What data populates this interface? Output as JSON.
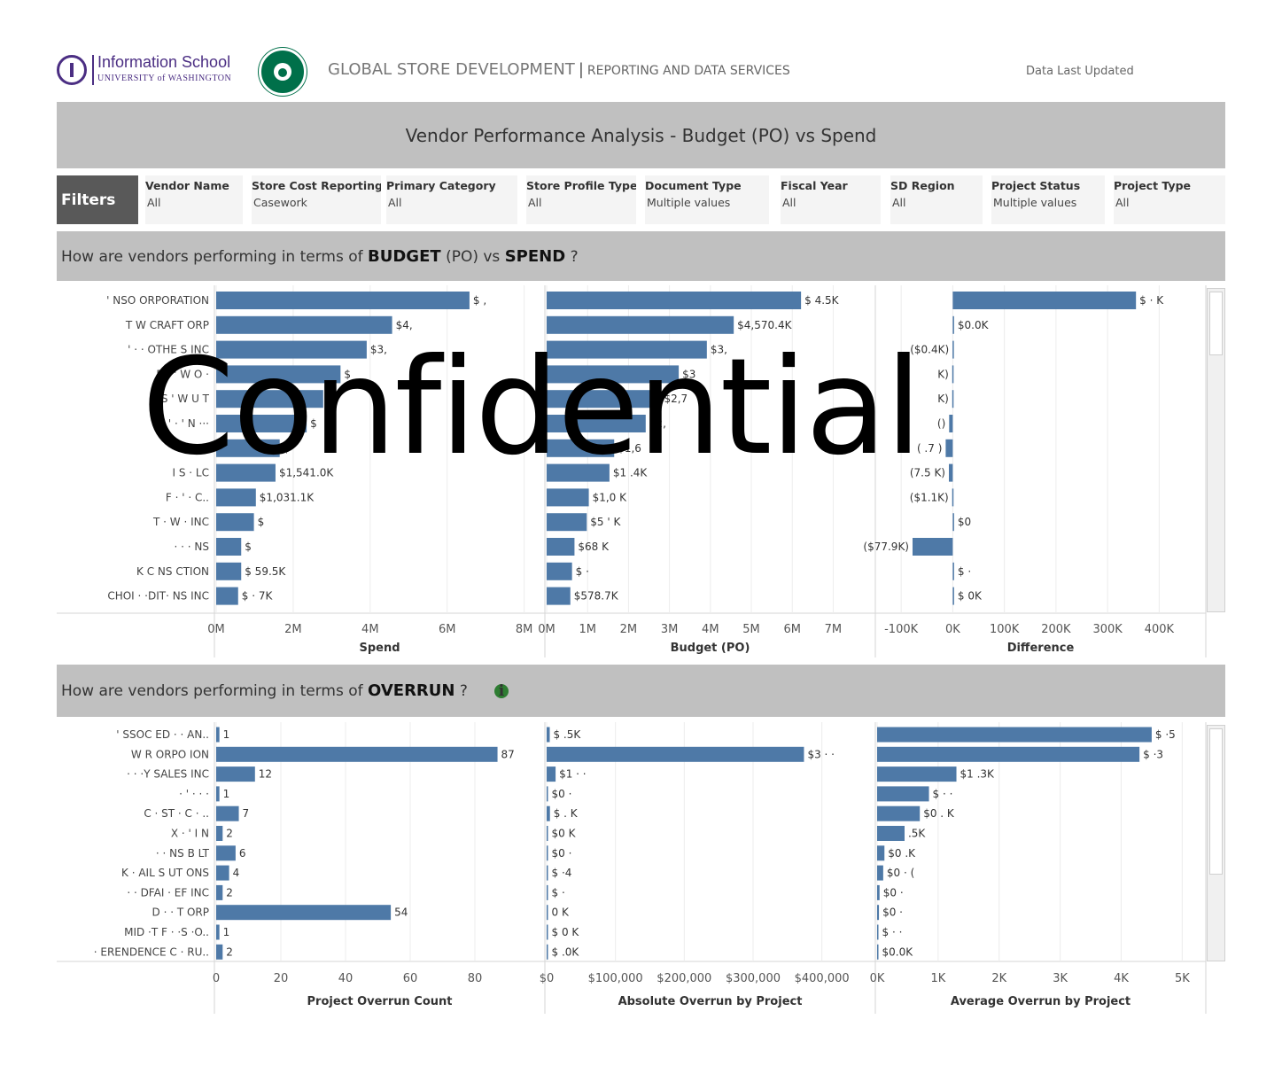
{
  "header": {
    "uw_name": "Information School",
    "uw_sub": "UNIVERSITY of WASHINGTON",
    "gsd": "GLOBAL STORE DEVELOPMENT",
    "sep": "|",
    "rds": "REPORTING AND DATA SERVICES",
    "updated": "Data Last Updated"
  },
  "title": "Vendor Performance Analysis - Budget (PO) vs Spend",
  "filters": {
    "label": "Filters",
    "items": [
      {
        "label": "Vendor Name",
        "value": "All"
      },
      {
        "label": "Store Cost Reporting ..",
        "value": "Casework"
      },
      {
        "label": "Primary Category",
        "value": "All"
      },
      {
        "label": "Store Profile Type",
        "value": "All"
      },
      {
        "label": "Document Type",
        "value": "Multiple values"
      },
      {
        "label": "Fiscal Year",
        "value": "All"
      },
      {
        "label": "SD Region",
        "value": "All"
      },
      {
        "label": "Project Status",
        "value": "Multiple values"
      },
      {
        "label": "Project Type",
        "value": "All"
      }
    ]
  },
  "section1": {
    "prefix": "How are vendors performing in terms of ",
    "emph1": "BUDGET",
    "mid": " (PO) vs ",
    "emph2": "SPEND",
    "suffix": " ?"
  },
  "section2": {
    "prefix": "How are vendors performing in terms of ",
    "emph": "OVERRUN",
    "suffix": " ?",
    "info": "i"
  },
  "watermark": "Confidential",
  "chart_data": [
    {
      "type": "bar",
      "orientation": "horizontal",
      "categories": [
        "' NSO   ORPORATION",
        "  T   W  CRAFT  ORP",
        "  ' ·  ·  OTHE  S INC",
        "  ER  '   W  O ·",
        "  '  S '   W  U  T",
        "' · '   N  ···",
        "  ' ' O    N..",
        "  I    S    ·  LC",
        "F   ·  '  ·   C..",
        "T   ·   W   · INC",
        "  ·   ·  · NS",
        "K  C   NS   CTION",
        "CHOI  ·  ·DIT·  NS INC"
      ],
      "values": [
        6580000,
        4570000,
        3910000,
        3230000,
        2780000,
        2350000,
        1650000,
        1541000,
        1031000,
        980000,
        650000,
        650000,
        570000
      ],
      "labels": [
        "$ ,",
        "$4,",
        "$3,",
        "$",
        "$",
        "$",
        "$",
        "$1,541.0K",
        "$1,031.1K",
        "$",
        "$",
        "$  59.5K",
        "$  ·  7K"
      ],
      "xlabel": "Spend",
      "ticks": [
        "0M",
        "2M",
        "4M",
        "6M",
        "8M"
      ],
      "xlim": [
        0,
        8400000
      ]
    },
    {
      "type": "bar",
      "orientation": "horizontal",
      "categories": [],
      "values": [
        6214500,
        4570400,
        3914000,
        3226900,
        2780000,
        2420000,
        1650000,
        1534400,
        1030000,
        980000,
        680000,
        620000,
        578700
      ],
      "labels": [
        "$   4.5K",
        "$4,570.4K",
        "$3,",
        "$3",
        "$2,7",
        "$2,",
        "$1,6",
        "$1   .4K",
        "$1,0   K",
        "$5  '  K",
        "$68   K",
        "$  ·",
        "$578.7K"
      ],
      "xlabel": "Budget (PO)",
      "ticks": [
        "0M",
        "1M",
        "2M",
        "3M",
        "4M",
        "5M",
        "6M",
        "7M"
      ],
      "xlim": [
        0,
        7900000
      ]
    },
    {
      "type": "bar",
      "orientation": "horizontal",
      "categories": [],
      "values": [
        355000,
        0,
        -400,
        -1000,
        -1000,
        -7000,
        -13700,
        -7500,
        -1100,
        500,
        -77900,
        200,
        100
      ],
      "labels": [
        "$   ·  K",
        "$0.0K",
        "($0.4K)",
        "  K)",
        "  K)",
        "  ()",
        "(  .7 )",
        "(7.5 K)",
        "($1.1K)",
        "$0",
        "($77.9K)",
        "$ ·",
        "$ 0K"
      ],
      "xlabel": "Difference",
      "ticks": [
        "-100K",
        "0K",
        "100K",
        "200K",
        "300K",
        "400K"
      ],
      "xlim": [
        -150000,
        480000
      ]
    },
    {
      "type": "bar",
      "orientation": "horizontal",
      "categories": [
        "'  SSOC   ED   ·   ·  AN..",
        "   W   R   ORPO   ION",
        "  ·   ·  ·Y SALES INC",
        "  ·  '   ·   ·  ·",
        "C   ·  ST  ·  C  ·  ..",
        "  X   ·  '    I   N",
        "  ·  ·  NS   B   LT",
        "K   ·   AIL S   UT  ONS",
        "  ·  · DFAI  ·   EF INC",
        "  D  ·     ·   T  ORP",
        "MID    ·T F   ·  ·S   ·O..",
        "  ·  ERENDENCE C  ·   RU.."
      ],
      "values": [
        1,
        87,
        12,
        1,
        7,
        2,
        6,
        4,
        2,
        54,
        1,
        2
      ],
      "labels": [
        "1",
        "87",
        "12",
        "1",
        "7",
        "2",
        "6",
        "4",
        "2",
        "54",
        "1",
        "2"
      ],
      "xlabel": "Project Overrun Count",
      "ticks": [
        "0",
        "20",
        "40",
        "60",
        "80"
      ],
      "xlim": [
        0,
        100
      ]
    },
    {
      "type": "bar",
      "orientation": "horizontal",
      "categories": [],
      "values": [
        4500,
        374000,
        13000,
        500,
        4800,
        400,
        350,
        500,
        300,
        300,
        300,
        400
      ],
      "labels": [
        "$  .5K",
        "$3  ·  ·",
        "$1  ·  ·",
        "$0  ·",
        "$  .  K",
        "$0   K",
        "$0  ·",
        "$  ·4",
        "$  ·",
        "  0  K",
        "$  0  K",
        "$  .0K"
      ],
      "xlabel": "Absolute Overrun by Project",
      "ticks": [
        "$0",
        "$100,000",
        "$200,000",
        "$300,000",
        "$400,000"
      ],
      "xlim": [
        0,
        470000
      ]
    },
    {
      "type": "bar",
      "orientation": "horizontal",
      "categories": [],
      "values": [
        4500,
        4300,
        1300,
        850,
        700,
        450,
        120,
        100,
        40,
        30,
        20,
        10
      ],
      "labels": [
        "$  ·5",
        "$  ·3",
        "$1  .3K",
        "$  ·  ·",
        "$0  .  K",
        "  .5K",
        "$0  .K",
        "$0  ·  (",
        "$0  ·",
        "$0  ·",
        "$  ·  ·",
        "$0.0K"
      ],
      "xlabel": "Average Overrun by Project",
      "ticks": [
        "0K",
        "1K",
        "2K",
        "3K",
        "4K",
        "5K"
      ],
      "xlim": [
        0,
        5300
      ]
    }
  ]
}
